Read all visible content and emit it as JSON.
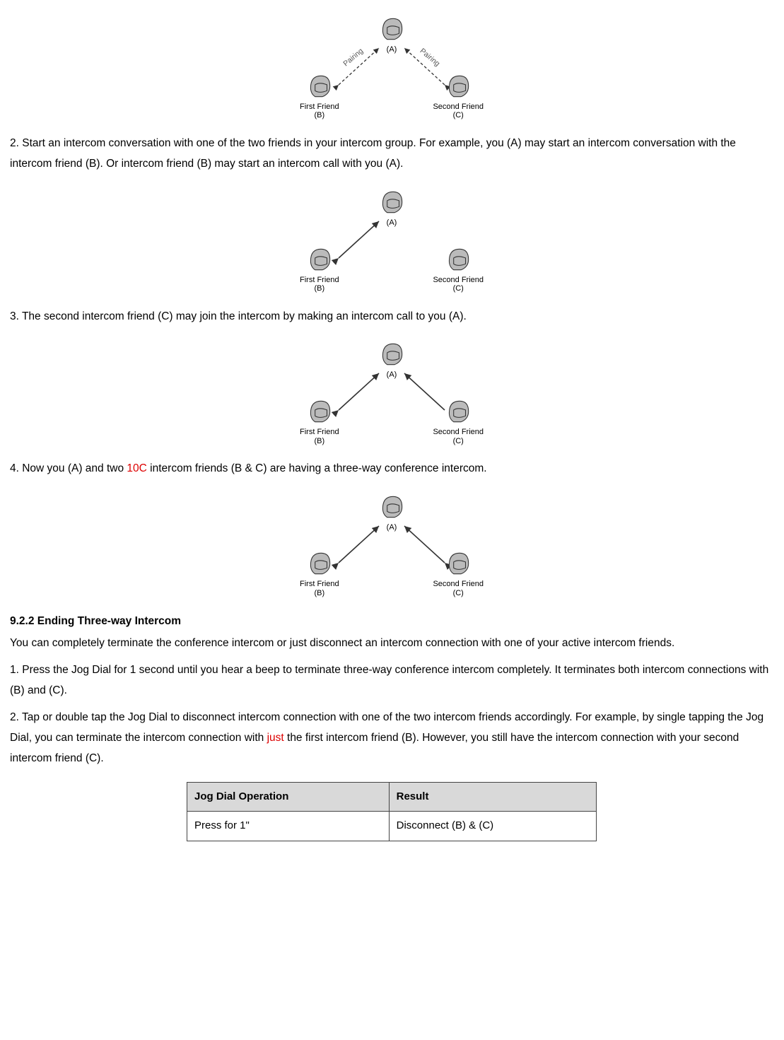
{
  "diagram_labels": {
    "top": "(A)",
    "left_name": "First Friend",
    "left_sub": "(B)",
    "right_name": "Second Friend",
    "right_sub": "(C)",
    "pairing": "Pairing"
  },
  "step2_a": "2. Start an intercom conversation with one of the two friends in your intercom group. For example, you (A) may start an intercom conversation with the intercom friend (B). Or intercom friend (B) may start an intercom call with you (A).",
  "step3": "3. The second intercom friend (C) may join the intercom by making an intercom call to you (A).",
  "step4_pre": "4. Now you (A) and two ",
  "step4_red": "10C",
  "step4_post": " intercom friends (B & C) are having a three-way conference intercom.",
  "heading_922": "9.2.2 Ending Three-way Intercom",
  "end_p1": "You can completely terminate the conference intercom or just disconnect an intercom connection with one of your active intercom friends.",
  "end_s1": "1. Press the Jog Dial for 1 second until you hear a beep to terminate three-way conference intercom completely. It terminates both intercom connections with (B) and (C).",
  "end_s2_pre": "2. Tap or double tap the Jog Dial to disconnect intercom connection with one of the two intercom friends accordingly. For example, by single tapping the Jog Dial, you can terminate the intercom connection with ",
  "end_s2_red": "just",
  "end_s2_post": " the first intercom friend (B). However, you still have the intercom connection with your second intercom friend (C).",
  "table": {
    "h1": "Jog Dial Operation",
    "h2": "Result",
    "r1c1": "Press for 1\"",
    "r1c2": "Disconnect (B) & (C)"
  }
}
